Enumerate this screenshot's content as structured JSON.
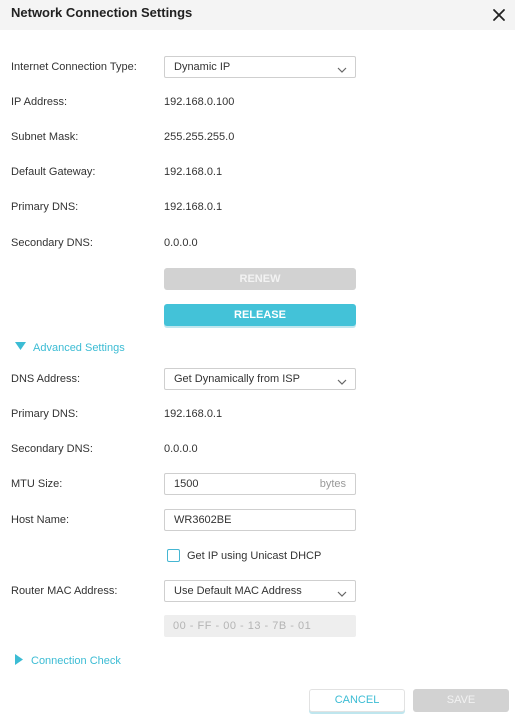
{
  "dialog": {
    "title": "Network Connection Settings"
  },
  "internet": {
    "connection_type_label": "Internet Connection Type:",
    "connection_type_value": "Dynamic IP",
    "ip_label": "IP Address:",
    "ip_value": "192.168.0.100",
    "subnet_label": "Subnet Mask:",
    "subnet_value": "255.255.255.0",
    "gateway_label": "Default Gateway:",
    "gateway_value": "192.168.0.1",
    "primary_dns_label": "Primary DNS:",
    "primary_dns_value": "192.168.0.1",
    "secondary_dns_label": "Secondary DNS:",
    "secondary_dns_value": "0.0.0.0",
    "renew_label": "RENEW",
    "release_label": "RELEASE"
  },
  "advanced": {
    "section_label": "Advanced Settings",
    "dns_address_label": "DNS Address:",
    "dns_address_value": "Get Dynamically from ISP",
    "primary_dns_label": "Primary DNS:",
    "primary_dns_value": "192.168.0.1",
    "secondary_dns_label": "Secondary DNS:",
    "secondary_dns_value": "0.0.0.0",
    "mtu_label": "MTU Size:",
    "mtu_value": "1500",
    "mtu_unit": "bytes",
    "host_name_label": "Host Name:",
    "host_name_value": "WR3602BE",
    "unicast_label": "Get IP using Unicast DHCP",
    "unicast_checked": false,
    "mac_label": "Router MAC Address:",
    "mac_mode_value": "Use Default MAC Address",
    "mac_value": "00 - FF - 00 - 13 - 7B - 01"
  },
  "connection_check": {
    "label": "Connection Check"
  },
  "footer": {
    "cancel_label": "CANCEL",
    "save_label": "SAVE"
  },
  "icons": {
    "close": "close-icon",
    "chevron": "chevron-down-icon",
    "expanded": "triangle-down-icon",
    "collapsed": "triangle-right-icon"
  },
  "colors": {
    "accent": "#43c2d8",
    "disabled": "#d2d2d2",
    "header_bg": "#f4f4f4"
  }
}
